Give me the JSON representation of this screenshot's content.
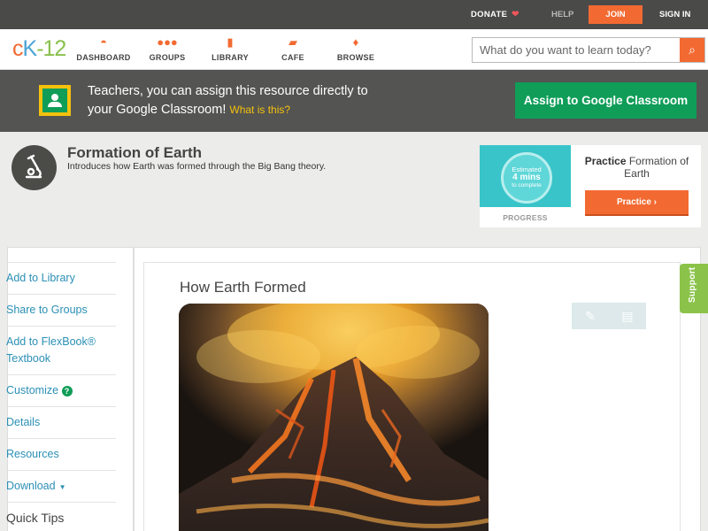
{
  "topbar": {
    "donate": "DONATE",
    "help": "HELP",
    "join": "JOIN",
    "signin": "SIGN IN"
  },
  "logo": {
    "c": "c",
    "k": "K",
    "dash": "-",
    "num": "12"
  },
  "nav": {
    "items": [
      {
        "label": "DASHBOARD",
        "icon": "dashboard-icon"
      },
      {
        "label": "GROUPS",
        "icon": "groups-icon"
      },
      {
        "label": "LIBRARY",
        "icon": "library-icon"
      },
      {
        "label": "CAFE",
        "icon": "cafe-icon"
      },
      {
        "label": "BROWSE",
        "icon": "browse-icon"
      }
    ]
  },
  "search": {
    "placeholder": "What do you want to learn today?"
  },
  "classroom": {
    "text": "Teachers, you can assign this resource directly to your Google Classroom!",
    "what": "What is this?",
    "button": "Assign to Google Classroom"
  },
  "concept": {
    "title": "Formation of Earth",
    "description": "Introduces how Earth was formed through the Big Bang theory."
  },
  "practice": {
    "estimated": "Estimated",
    "mins": "4 mins",
    "complete": "to complete",
    "progress_label": "PROGRESS",
    "title_prefix": "Practice",
    "title": "Formation of Earth",
    "button": "Practice"
  },
  "sidebar": {
    "items": [
      {
        "label": "Add to Library"
      },
      {
        "label": "Share to Groups"
      },
      {
        "label": "Add to FlexBook® Textbook"
      },
      {
        "label": "Customize"
      },
      {
        "label": "Details"
      },
      {
        "label": "Resources"
      },
      {
        "label": "Download"
      },
      {
        "label": "Quick Tips"
      }
    ]
  },
  "content": {
    "title": "How Earth Formed"
  },
  "support": "Support",
  "colors": {
    "accent": "#f26a32",
    "google_green": "#0f9d58",
    "link": "#2b8fb5",
    "support": "#8bc34a"
  }
}
